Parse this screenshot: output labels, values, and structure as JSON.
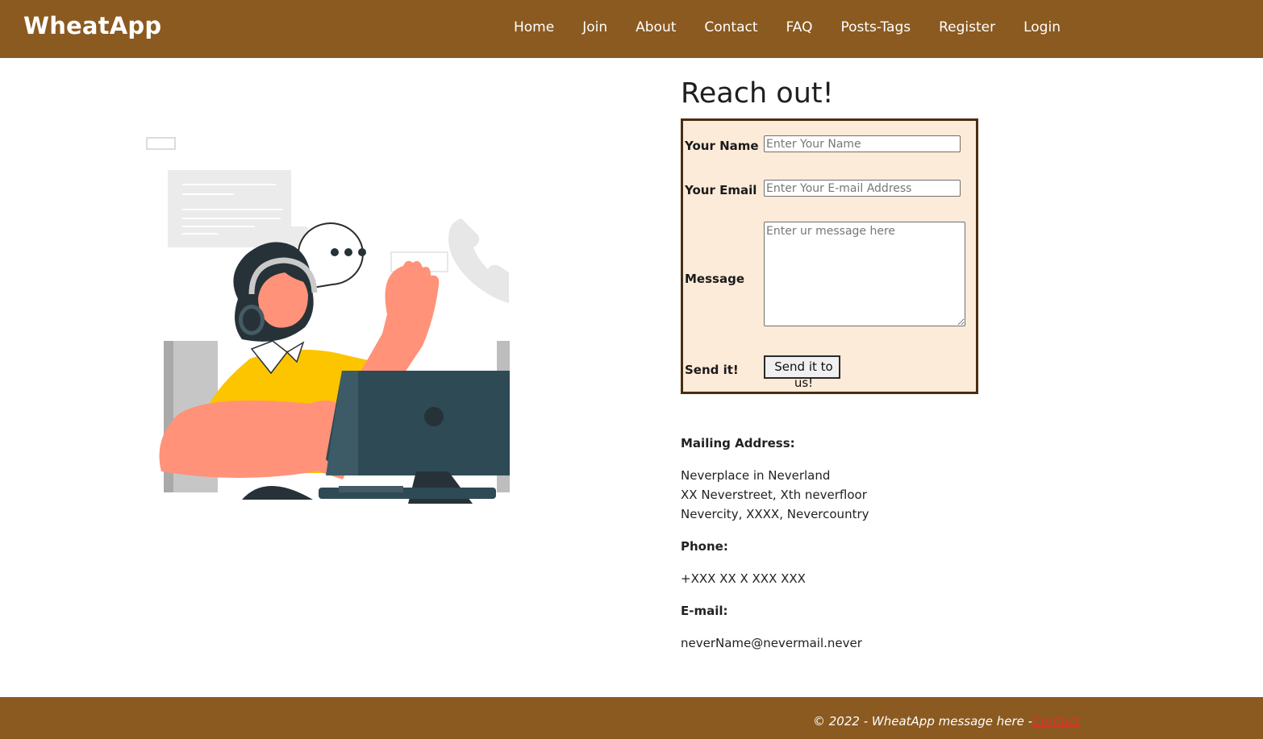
{
  "header": {
    "brand": "WheatApp",
    "nav": [
      "Home",
      "Join",
      "About",
      "Contact",
      "FAQ",
      "Posts-Tags",
      "Register",
      "Login"
    ]
  },
  "contact": {
    "heading": "Reach out!",
    "form": {
      "name_label": "Your Name",
      "name_placeholder": "Enter Your Name",
      "email_label": "Your Email",
      "email_placeholder": "Enter Your E-mail Address",
      "message_label": "Message",
      "message_placeholder": "Enter ur message here",
      "send_label": "Send it!",
      "send_button_line1": "Send it to",
      "send_button_line2": "us!"
    },
    "mailing_heading": "Mailing Address:",
    "address": [
      "Neverplace in Neverland",
      "XX Neverstreet, Xth neverfloor",
      "Nevercity, XXXX, Nevercountry"
    ],
    "phone_heading": "Phone:",
    "phone": "+XXX XX X XXX XXX",
    "email_heading": "E-mail:",
    "email": "neverName@nevermail.never"
  },
  "footer": {
    "text": "© 2022 - WheatApp message here -",
    "link": "Contact"
  },
  "colors": {
    "bar": "#8b5a20",
    "form_bg": "#fbebd8",
    "form_border": "#4a2d10",
    "footer_link": "#e0322b"
  }
}
